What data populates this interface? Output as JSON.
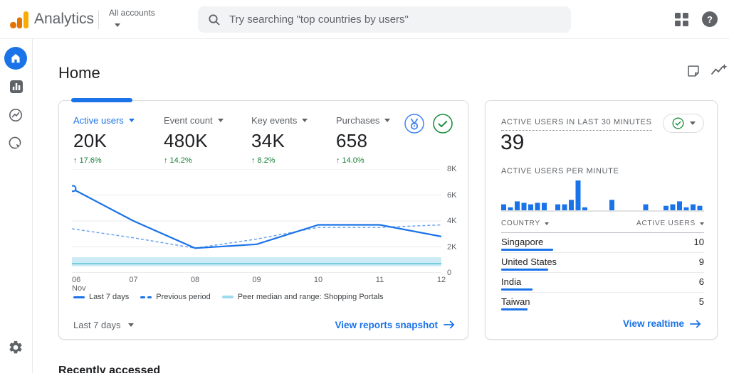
{
  "topbar": {
    "brand": "Analytics",
    "account_label": "All accounts",
    "search_placeholder": "Try searching \"top countries by users\""
  },
  "page": {
    "title": "Home",
    "section_below": "Recently accessed"
  },
  "overview_card": {
    "metrics": [
      {
        "label": "Active users",
        "value": "20K",
        "delta": "17.6%",
        "selected": true
      },
      {
        "label": "Event count",
        "value": "480K",
        "delta": "14.2%",
        "selected": false
      },
      {
        "label": "Key events",
        "value": "34K",
        "delta": "8.2%",
        "selected": false
      },
      {
        "label": "Purchases",
        "value": "658",
        "delta": "14.0%",
        "selected": false
      }
    ],
    "date_range_label": "Last 7 days",
    "snapshot_link": "View reports snapshot"
  },
  "realtime_card": {
    "title": "ACTIVE USERS IN LAST 30 MINUTES",
    "value": "39",
    "table": {
      "headers": [
        "COUNTRY",
        "ACTIVE USERS"
      ],
      "rows": [
        {
          "country": "Singapore",
          "active_users": 10
        },
        {
          "country": "United States",
          "active_users": 9
        },
        {
          "country": "India",
          "active_users": 6
        },
        {
          "country": "Taiwan",
          "active_users": 5
        }
      ],
      "max_users": 10
    },
    "realtime_link": "View realtime"
  },
  "chart_data": [
    {
      "id": "active-users-trend",
      "type": "line",
      "x": [
        "06",
        "07",
        "08",
        "09",
        "10",
        "11",
        "12"
      ],
      "x_sub": "Nov",
      "series": [
        {
          "name": "Last 7 days",
          "style": "solid",
          "values": [
            6500,
            4000,
            1900,
            2200,
            3700,
            3700,
            2800
          ]
        },
        {
          "name": "Previous period",
          "style": "dashed",
          "values": [
            3400,
            2700,
            1900,
            2600,
            3500,
            3500,
            3700
          ]
        }
      ],
      "peer_band": {
        "name": "Peer median and range: Shopping Portals",
        "low": 500,
        "median": 700,
        "high": 1200
      },
      "ylim": [
        0,
        8000
      ],
      "yticks": [
        "8K",
        "6K",
        "4K",
        "2K",
        "0"
      ],
      "grid": true,
      "legend_position": "bottom"
    },
    {
      "id": "active-users-per-minute",
      "type": "bar",
      "title": "ACTIVE USERS PER MINUTE",
      "values": [
        2,
        1,
        3,
        2.5,
        2,
        2.5,
        2.5,
        0,
        2,
        2,
        3.5,
        10,
        1,
        0,
        0,
        0,
        3.5,
        0,
        0,
        0,
        0,
        2,
        0,
        0,
        1.5,
        2,
        3,
        1,
        2,
        1.5
      ],
      "ylim": [
        0,
        10
      ]
    }
  ],
  "colors": {
    "accent_blue": "#1a73e8",
    "delta_green": "#188038",
    "peer_band": "#cdebf5",
    "peer_median": "#53c0d4",
    "grid_line": "#e8eaed",
    "axis_line": "#d5d8dc"
  }
}
